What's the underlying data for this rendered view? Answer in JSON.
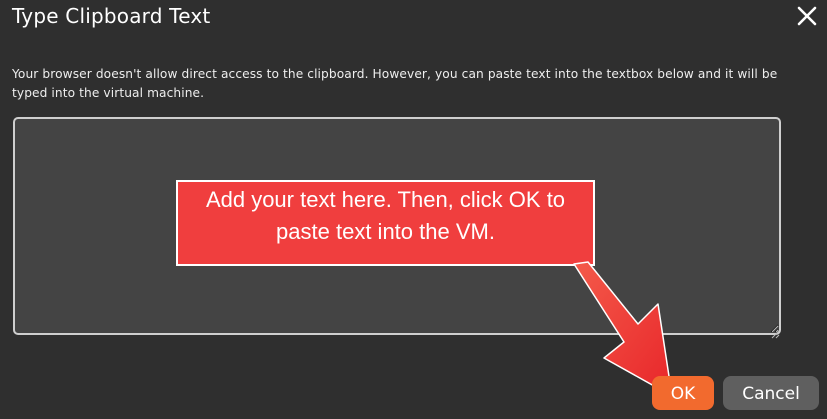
{
  "dialog": {
    "title": "Type Clipboard Text",
    "close_icon": "close-icon",
    "description": "Your browser doesn't allow direct access to the clipboard. However, you can paste text into the textbox below and it will be typed into the virtual machine.",
    "textarea_value": ""
  },
  "annotation": {
    "callout_line1": "Add your text here. Then, click OK to",
    "callout_line2": "paste text into the VM.",
    "callout_color": "#f03e3e",
    "arrow_color": "#f0352f"
  },
  "buttons": {
    "ok_label": "OK",
    "cancel_label": "Cancel",
    "ok_color": "#f26a2e",
    "cancel_color": "#5f5f5f"
  }
}
